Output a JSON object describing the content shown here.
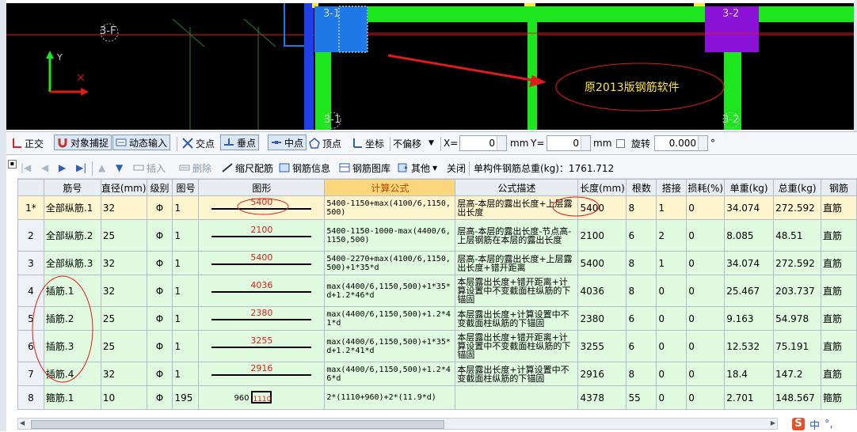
{
  "cad": {
    "labels": {
      "axis_3f": "3-F",
      "col_3_1_top": "3-1",
      "col_3_2_top": "3-2",
      "col_3_1_bot": "3-1",
      "col_3_2_bot": "3-2",
      "axis_y": "Y"
    },
    "annotation": "原2013版钢筋软件",
    "colors": {
      "background": "#000000",
      "beam": "#1ee61e",
      "column_blue": "#1e78e6",
      "column_purple": "#8a12d6",
      "annotation": "#ffe640",
      "axis_red": "#e01b1b"
    }
  },
  "toolbar1": {
    "zhengjiao": "正交",
    "duixiang": "对象捕捉",
    "dongtai": "动态输入",
    "jiaodian": "交点",
    "chuidian": "垂点",
    "zhongdian": "中点",
    "dingdian": "顶点",
    "zuobiao": "坐标",
    "offset": "不偏移",
    "x_label": "X=",
    "x_value": "0",
    "x_unit": "mm",
    "y_label": "Y=",
    "y_value": "0",
    "y_unit": "mm",
    "rotate": "旋转",
    "rotate_value": "0.000",
    "degree": "°"
  },
  "toolbar2": {
    "insert": "插入",
    "delete": "删除",
    "scale": "缩尺配筋",
    "info": "钢筋信息",
    "library": "钢筋图库",
    "other": "其他",
    "close": "关闭",
    "total_label": "单构件钢筋总重(kg)：1761.712"
  },
  "table": {
    "headers": [
      "筋号",
      "直径(mm)",
      "级别",
      "图号",
      "图形",
      "计算公式",
      "公式描述",
      "长度(mm)",
      "根数",
      "搭接",
      "损耗(%)",
      "单重(kg)",
      "总重(kg)",
      "钢筋"
    ],
    "rows": [
      {
        "rn": "1*",
        "name": "全部纵筋.1",
        "dia": "32",
        "grade": "Φ",
        "fig": "1",
        "shape_val": "5400",
        "formula": "5400-1150+max(4100/6,1150,500)",
        "desc": "层高-本层的露出长度+上层露出长度",
        "len": "5400",
        "count": "8",
        "lap": "1",
        "loss": "0",
        "unit_w": "34.074",
        "total_w": "272.592",
        "type": "直筋"
      },
      {
        "rn": "2",
        "name": "全部纵筋.2",
        "dia": "25",
        "grade": "Φ",
        "fig": "1",
        "shape_val": "2100",
        "formula": "5400-1150-1000-max(4400/6,1150,500)",
        "desc": "层高-本层的露出长度-节点高-上层钢筋在本层的露出长度",
        "len": "2100",
        "count": "6",
        "lap": "2",
        "loss": "0",
        "unit_w": "8.085",
        "total_w": "48.51",
        "type": "直筋"
      },
      {
        "rn": "3",
        "name": "全部纵筋.3",
        "dia": "32",
        "grade": "Φ",
        "fig": "1",
        "shape_val": "5400",
        "formula": "5400-2270+max(4100/6,1150,500)+1*35*d",
        "desc": "层高-本层的露出长度+上层露出长度+错开距离",
        "len": "5400",
        "count": "8",
        "lap": "1",
        "loss": "0",
        "unit_w": "34.074",
        "total_w": "272.592",
        "type": "直筋"
      },
      {
        "rn": "4",
        "name": "插筋.1",
        "dia": "32",
        "grade": "Φ",
        "fig": "1",
        "shape_val": "4036",
        "formula": "max(4400/6,1150,500)+1*35*d+1.2*46*d",
        "desc": "本层露出长度+错开距离+计算设置中不变截面柱纵筋的下锚固",
        "len": "4036",
        "count": "8",
        "lap": "0",
        "loss": "0",
        "unit_w": "25.467",
        "total_w": "203.737",
        "type": "直筋"
      },
      {
        "rn": "5",
        "name": "插筋.2",
        "dia": "25",
        "grade": "Φ",
        "fig": "1",
        "shape_val": "2380",
        "formula": "max(4400/6,1150,500)+1.2*41*d",
        "desc": "本层露出长度+计算设置中不变截面柱纵筋的下锚固",
        "len": "2380",
        "count": "6",
        "lap": "0",
        "loss": "0",
        "unit_w": "9.163",
        "total_w": "54.978",
        "type": "直筋"
      },
      {
        "rn": "6",
        "name": "插筋.3",
        "dia": "25",
        "grade": "Φ",
        "fig": "1",
        "shape_val": "3255",
        "formula": "max(4400/6,1150,500)+1*35*d+1.2*41*d",
        "desc": "本层露出长度+错开距离+计算设置中不变截面柱纵筋的下锚固",
        "len": "3255",
        "count": "6",
        "lap": "0",
        "loss": "0",
        "unit_w": "12.532",
        "total_w": "75.191",
        "type": "直筋"
      },
      {
        "rn": "7",
        "name": "插筋.4",
        "dia": "32",
        "grade": "Φ",
        "fig": "1",
        "shape_val": "2916",
        "formula": "max(4400/6,1150,500)+1.2*46*d",
        "desc": "本层露出长度+计算设置中不变截面柱纵筋的下锚固",
        "len": "2916",
        "count": "8",
        "lap": "0",
        "loss": "0",
        "unit_w": "18.4",
        "total_w": "147.2",
        "type": "直筋"
      },
      {
        "rn": "8",
        "name": "箍筋.1",
        "dia": "10",
        "grade": "Φ",
        "fig": "195",
        "shape_w": "960",
        "shape_h": "1110",
        "formula": "2*(1110+960)+2*(11.9*d)",
        "desc": "",
        "len": "4378",
        "count": "55",
        "lap": "0",
        "loss": "0",
        "unit_w": "2.701",
        "total_w": "148.567",
        "type": "箍筋"
      }
    ]
  },
  "ime": {
    "zh": "中",
    "punct": "°,",
    "logo": "S"
  }
}
